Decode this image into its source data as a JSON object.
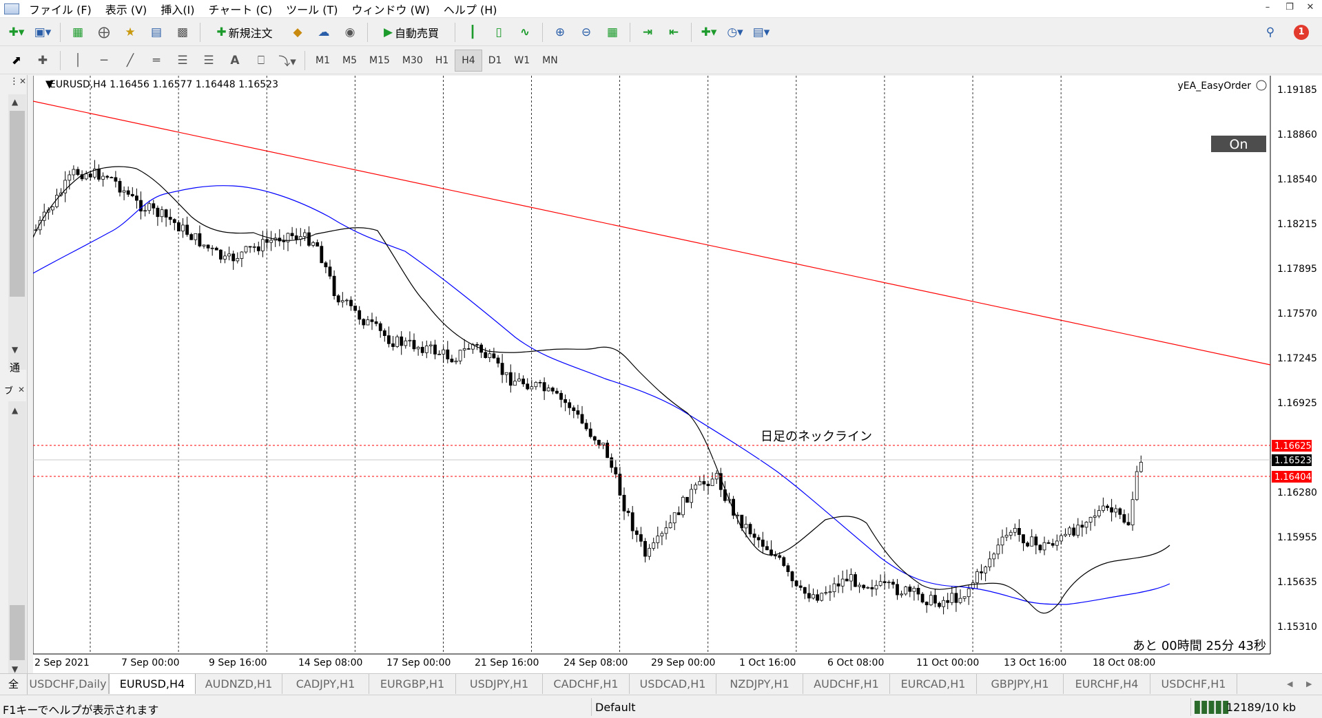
{
  "menu": {
    "items": [
      "ファイル (F)",
      "表示 (V)",
      "挿入(I)",
      "チャート (C)",
      "ツール (T)",
      "ウィンドウ (W)",
      "ヘルプ (H)"
    ]
  },
  "toolbar": {
    "new_order_label": "新規注文",
    "auto_trade_label": "自動売買",
    "notification_count": "1",
    "timeframes": [
      "M1",
      "M5",
      "M15",
      "M30",
      "H1",
      "H4",
      "D1",
      "W1",
      "MN"
    ],
    "active_timeframe": "H4"
  },
  "left_panel": {
    "top_label": "通",
    "bottom_label": "ブ",
    "all_label": "全"
  },
  "chart": {
    "header": "EURUSD,H4  1.16456 1.16577 1.16448 1.16523",
    "ea_name": "yEA_EasyOrder",
    "on_button_label": "On",
    "neckline_annotation": "日足のネックライン",
    "countdown": "あと 00時間  25分 43秒",
    "price_labels": [
      "1.19185",
      "1.18860",
      "1.18540",
      "1.18215",
      "1.17895",
      "1.17570",
      "1.17245",
      "1.16925",
      "1.16280",
      "1.15955",
      "1.15635",
      "1.15310"
    ],
    "marker_labels": {
      "upper_line": "1.16625",
      "current_price": "1.16523",
      "lower_line": "1.16404"
    },
    "time_labels": [
      "2 Sep 2021",
      "7 Sep 00:00",
      "9 Sep 16:00",
      "14 Sep 08:00",
      "17 Sep 00:00",
      "21 Sep 16:00",
      "24 Sep 08:00",
      "29 Sep 00:00",
      "1 Oct 16:00",
      "6 Oct 08:00",
      "11 Oct 00:00",
      "13 Oct 16:00",
      "18 Oct 08:00"
    ],
    "colors": {
      "trendline": "#ff0000",
      "ma_fast": "#000000",
      "ma_slow": "#0000ff",
      "bid_label_bg": "#000000",
      "level_label_bg": "#ff0000"
    }
  },
  "tabs": [
    {
      "label": "USDCHF,Daily",
      "active": false
    },
    {
      "label": "EURUSD,H4",
      "active": true
    },
    {
      "label": "AUDNZD,H1",
      "active": false
    },
    {
      "label": "CADJPY,H1",
      "active": false
    },
    {
      "label": "EURGBP,H1",
      "active": false
    },
    {
      "label": "USDJPY,H1",
      "active": false
    },
    {
      "label": "CADCHF,H1",
      "active": false
    },
    {
      "label": "USDCAD,H1",
      "active": false
    },
    {
      "label": "NZDJPY,H1",
      "active": false
    },
    {
      "label": "AUDCHF,H1",
      "active": false
    },
    {
      "label": "EURCAD,H1",
      "active": false
    },
    {
      "label": "GBPJPY,H1",
      "active": false
    },
    {
      "label": "EURCHF,H4",
      "active": false
    },
    {
      "label": "USDCHF,H1",
      "active": false
    }
  ],
  "status": {
    "help_text": "F1キーでヘルプが表示されます",
    "profile": "Default",
    "traffic": "12189/10 kb"
  }
}
